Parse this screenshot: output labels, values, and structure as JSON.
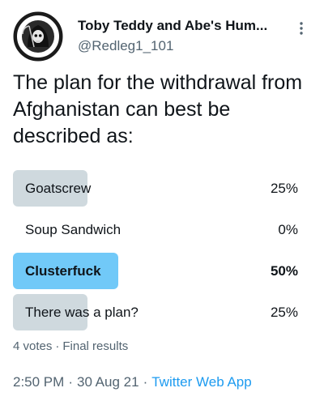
{
  "author": {
    "display_name": "Toby Teddy and Abe's Hum...",
    "handle": "@Redleg1_101",
    "avatar": {
      "icon": "sons-of-belichick-skull-logo",
      "top_text": "SONS OF BELICHICK",
      "bottom_text": "FOXBORO"
    }
  },
  "more_icon": "more-dots-icon",
  "tweet_text": "The plan for the withdrawal from Afghanistan can best be described as:",
  "poll": {
    "options": [
      {
        "label": "Goatscrew",
        "percent_text": "25%",
        "percent": 25,
        "winner": false
      },
      {
        "label": "Soup Sandwich",
        "percent_text": "0%",
        "percent": 0,
        "winner": false
      },
      {
        "label": "Clusterfuck",
        "percent_text": "50%",
        "percent": 50,
        "winner": true
      },
      {
        "label": "There was a plan?",
        "percent_text": "25%",
        "percent": 25,
        "winner": false
      }
    ],
    "votes": "4 votes",
    "status": "Final results"
  },
  "footer": {
    "time": "2:50 PM",
    "date": "30 Aug 21",
    "source": "Twitter Web App"
  },
  "colors": {
    "bar": "#cfd9de",
    "winner_bar": "#71c9f8",
    "link": "#1d9bf0",
    "secondary_text": "#536471"
  }
}
